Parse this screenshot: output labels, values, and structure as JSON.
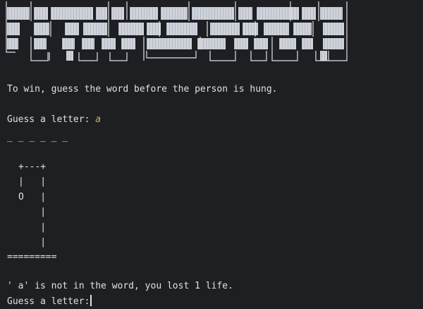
{
  "terminal": {
    "intro_text": "To win, guess the word before the person is hung.",
    "first_prompt": "Guess a letter: ",
    "first_input": "a",
    "word_blanks": "_ _ _ _ _ _",
    "gallows": {
      "lines": [
        "+---+",
        "|   |",
        "O   |",
        "    |",
        "    |",
        "    |"
      ],
      "base": "========="
    },
    "result_message": "' a' is not in the word, you lost 1 life.",
    "second_prompt": "Guess a letter:"
  },
  "colors": {
    "background": "#1e1f22",
    "text": "#dfe1e5",
    "input_text": "#c9b26b"
  }
}
